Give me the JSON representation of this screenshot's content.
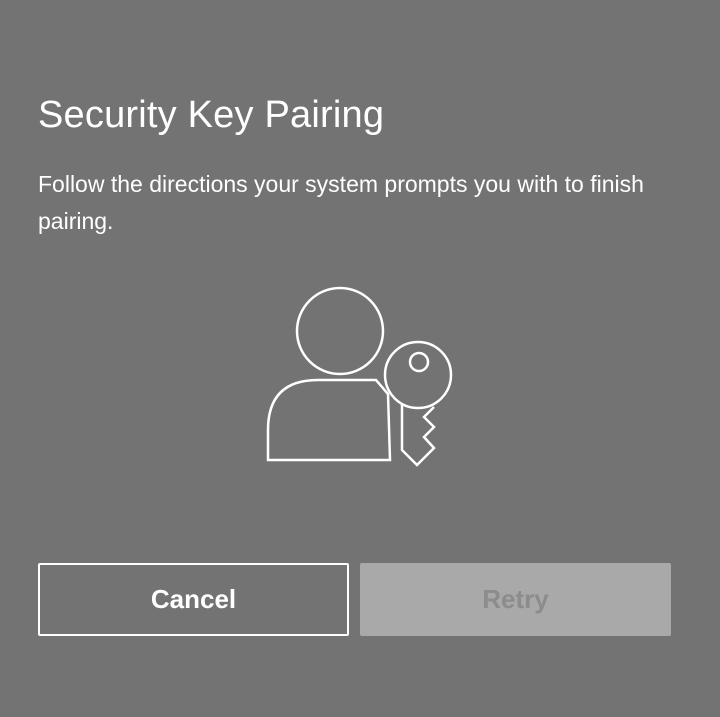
{
  "dialog": {
    "title": "Security Key Pairing",
    "description": "Follow the directions your system prompts you with to finish pairing.",
    "illustration_icon": "user-with-key-icon",
    "cancel_label": "Cancel",
    "retry_label": "Retry",
    "retry_disabled": true
  },
  "colors": {
    "background": "#737373",
    "text": "#ffffff",
    "retry_bg": "#a9a9a9",
    "retry_text": "#8c8c8c"
  }
}
